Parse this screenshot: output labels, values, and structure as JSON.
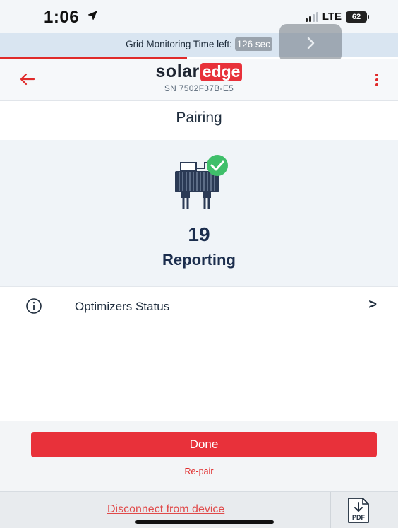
{
  "status_bar": {
    "time": "1:06",
    "network": "LTE",
    "battery": "62"
  },
  "grid_banner": {
    "text_prefix": "Grid Monitoring Time left: ",
    "seconds": "126 sec",
    "progress_percent": 47
  },
  "header": {
    "logo_solar": "solar",
    "logo_edge": "edge",
    "serial": "SN 7502F37B-E5"
  },
  "page": {
    "title": "Pairing"
  },
  "summary": {
    "icon": "optimizer-check-icon",
    "count": "19",
    "label": "Reporting"
  },
  "status_row": {
    "icon": "info-icon",
    "label": "Optimizers Status",
    "chevron": ">"
  },
  "actions": {
    "done_label": "Done",
    "repair_label": "Re-pair"
  },
  "footer": {
    "disconnect_label": "Disconnect from device",
    "pdf_icon": "pdf-download-icon",
    "pdf_text": "PDF"
  },
  "colors": {
    "accent": "#e8313a",
    "banner_bg": "#d9e5f1",
    "navy_text": "#1b2d4d",
    "success_green": "#3fbf6a"
  }
}
